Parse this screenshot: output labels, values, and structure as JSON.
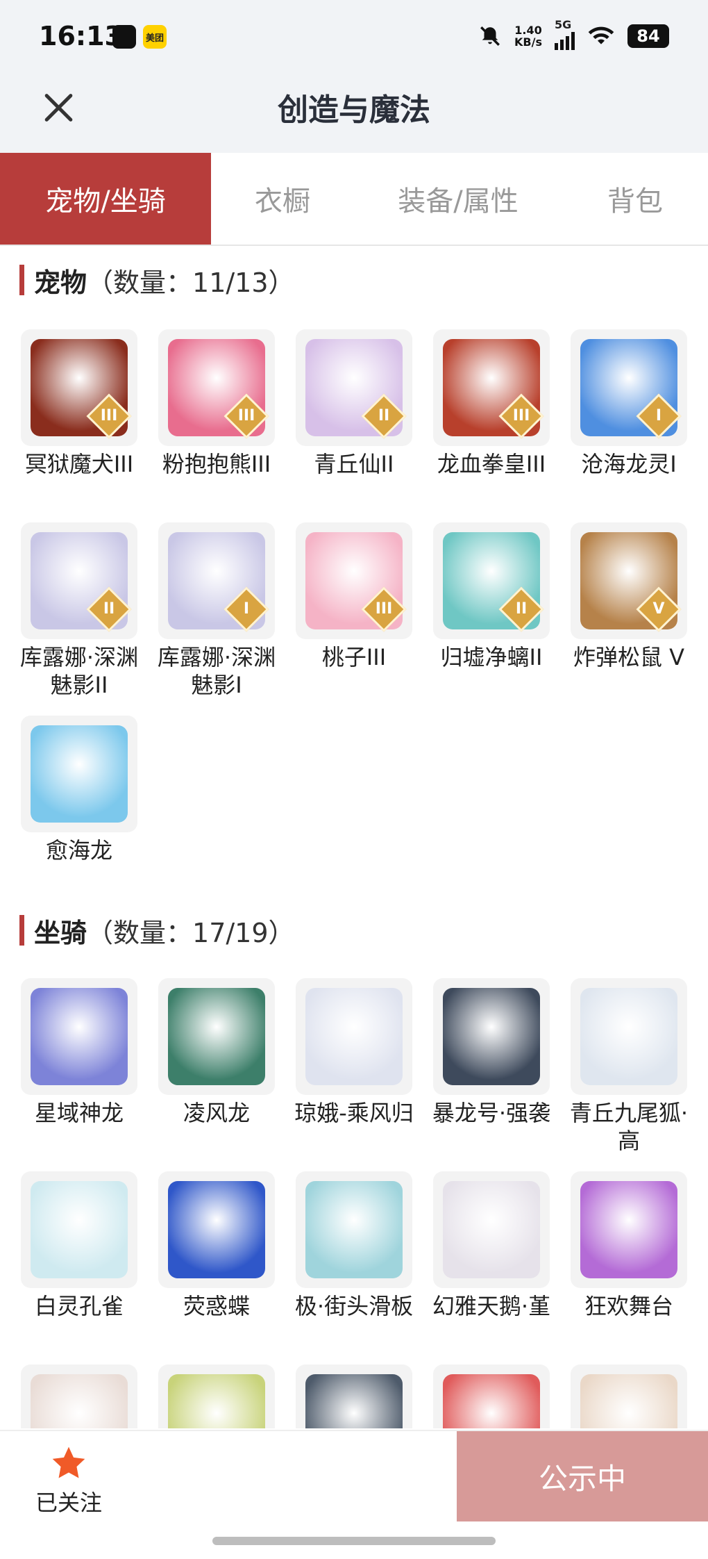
{
  "status": {
    "time": "16:13",
    "net_speed": "1.40",
    "net_unit": "KB/s",
    "net_type": "5G",
    "battery": "84",
    "app_badge_meituan": "美团"
  },
  "header": {
    "title": "创造与魔法"
  },
  "tabs": [
    {
      "label": "宠物/坐骑",
      "active": true
    },
    {
      "label": "衣橱",
      "active": false
    },
    {
      "label": "装备/属性",
      "active": false
    },
    {
      "label": "背包",
      "active": false
    }
  ],
  "pets": {
    "title": "宠物",
    "count": "（数量：11/13）",
    "items": [
      {
        "name": "冥狱魔犬III",
        "tier": "III",
        "color": "#8a2d1d"
      },
      {
        "name": "粉抱抱熊III",
        "tier": "III",
        "color": "#e86d8e"
      },
      {
        "name": "青丘仙II",
        "tier": "II",
        "color": "#d7c0e8"
      },
      {
        "name": "龙血拳皇III",
        "tier": "III",
        "color": "#b8402c"
      },
      {
        "name": "沧海龙灵I",
        "tier": "I",
        "color": "#4f8fe0"
      },
      {
        "name": "库露娜·深渊魅影II",
        "tier": "II",
        "color": "#c9c7e6"
      },
      {
        "name": "库露娜·深渊魅影I",
        "tier": "I",
        "color": "#c9c7e6"
      },
      {
        "name": "桃子III",
        "tier": "III",
        "color": "#f5b3c6"
      },
      {
        "name": "归墟净螭II",
        "tier": "II",
        "color": "#6fc7c4"
      },
      {
        "name": "炸弹松鼠 V",
        "tier": "V",
        "color": "#b6824a"
      },
      {
        "name": "愈海龙",
        "tier": "",
        "color": "#7cc8ec"
      }
    ]
  },
  "mounts": {
    "title": "坐骑",
    "count": "（数量：17/19）",
    "items": [
      {
        "name": "星域神龙",
        "color": "#7d83d8"
      },
      {
        "name": "凌风龙",
        "color": "#3d7f6a"
      },
      {
        "name": "琼娥-乘风归",
        "color": "#dfe3ef"
      },
      {
        "name": "暴龙号·强袭",
        "color": "#3e4a5c"
      },
      {
        "name": "青丘九尾狐·高",
        "color": "#dfe6ef"
      },
      {
        "name": "白灵孔雀",
        "color": "#cfeaf0"
      },
      {
        "name": "荧惑蝶",
        "color": "#2f57c9"
      },
      {
        "name": "极·街头滑板",
        "color": "#9fd4dc"
      },
      {
        "name": "幻雅天鹅·堇",
        "color": "#e6e2ea"
      },
      {
        "name": "狂欢舞台",
        "color": "#b46bd6"
      },
      {
        "name": "",
        "color": "#e9dcd6"
      },
      {
        "name": "",
        "color": "#c8d37a"
      },
      {
        "name": "",
        "color": "#4e5b6b"
      },
      {
        "name": "",
        "color": "#e05b5b"
      },
      {
        "name": "",
        "color": "#ead8c8"
      }
    ]
  },
  "bottom": {
    "follow_label": "已关注",
    "publish_label": "公示中"
  },
  "colors": {
    "accent": "#b73d3b",
    "publish_bg": "#d79a98",
    "star": "#f05a28"
  }
}
